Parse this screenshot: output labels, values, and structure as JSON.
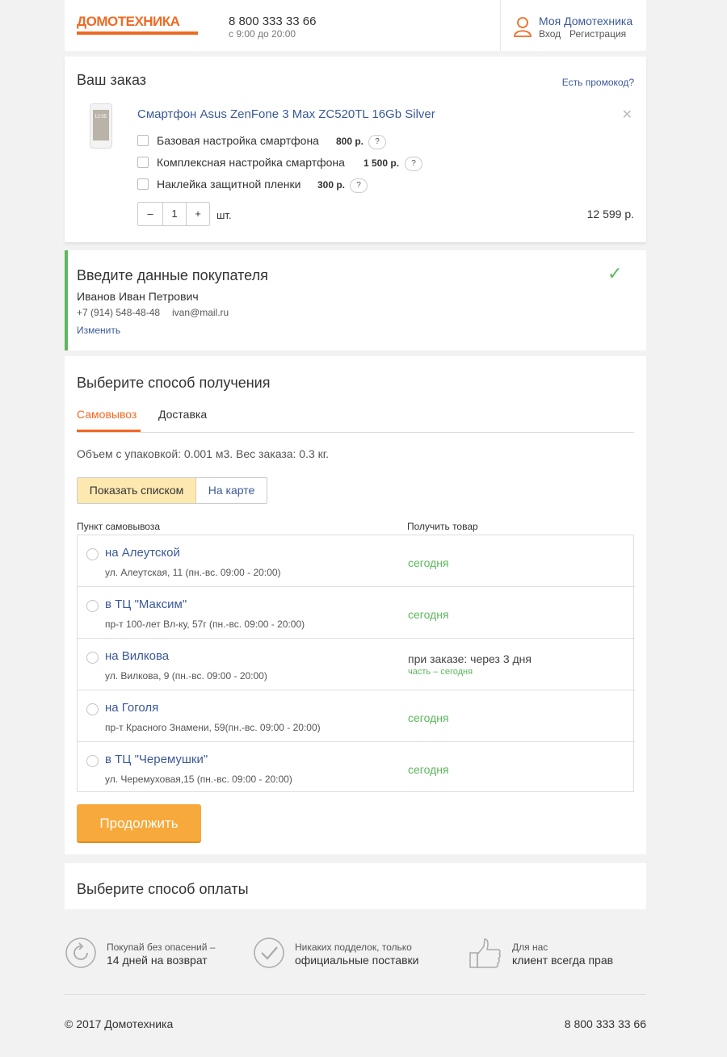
{
  "header": {
    "logo_text": "ДОМОТЕХНИКА",
    "phone": "8 800 333 33 66",
    "hours": "с 9:00 до 20:00",
    "account_title": "Моя Домотехника",
    "login": "Вход",
    "register": "Регистрация"
  },
  "order": {
    "title": "Ваш заказ",
    "promo_link": "Есть промокод?",
    "product_name": "Смартфон Asus ZenFone 3 Max ZC520TL 16Gb Silver",
    "phone_screen_time": "12:05",
    "options": [
      {
        "label": "Базовая настройка смартфона",
        "price": "800 р.",
        "help": "?"
      },
      {
        "label": "Комплексная настройка смартфона",
        "price": "1 500 р.",
        "help": "?"
      },
      {
        "label": "Наклейка защитной пленки",
        "price": "300 р.",
        "help": "?"
      }
    ],
    "qty_minus": "–",
    "qty_value": "1",
    "qty_plus": "+",
    "qty_unit": "шт.",
    "total": "12 599 р.",
    "remove": "✕"
  },
  "buyer": {
    "title": "Введите данные покупателя",
    "name": "Иванов Иван Петрович",
    "phone": "+7 (914) 548-48-48",
    "email": "ivan@mail.ru",
    "edit_link": "Изменить",
    "done_icon": "✓"
  },
  "delivery": {
    "title": "Выберите способ получения",
    "tabs": [
      "Самовывоз",
      "Доставка"
    ],
    "active_tab": 0,
    "volume_text": "Объем с упаковкой: 0.001 м3. Вес заказа: 0.3 кг.",
    "view_list": "Показать списком",
    "view_map": "На карте",
    "col_point": "Пункт самовывоза",
    "col_get": "Получить товар",
    "points": [
      {
        "name": "на Алеутской",
        "address": "ул. Алеутская, 11 (пн.-вс. 09:00 - 20:00)",
        "get": "сегодня",
        "sub": ""
      },
      {
        "name": "в ТЦ \"Максим\"",
        "address": "пр-т 100-лет Вл-ку, 57г (пн.-вс. 09:00 - 20:00)",
        "get": "сегодня",
        "sub": ""
      },
      {
        "name": "на Вилкова",
        "address": "ул. Вилкова, 9 (пн.-вс. 09:00 - 20:00)",
        "get": "при заказе: через 3 дня",
        "sub": "часть – сегодня"
      },
      {
        "name": "на Гоголя",
        "address": "пр-т Красного Знамени, 59(пн.-вс. 09:00 - 20:00)",
        "get": "сегодня",
        "sub": ""
      },
      {
        "name": "в ТЦ \"Черемушки\"",
        "address": "ул. Черемуховая,15 (пн.-вс. 09:00 - 20:00)",
        "get": "сегодня",
        "sub": ""
      }
    ],
    "continue": "Продолжить"
  },
  "payment": {
    "title": "Выберите способ оплаты"
  },
  "benefits": [
    {
      "top": "Покупай без опасений –",
      "bottom": "14 дней на возврат",
      "icon": "return-icon"
    },
    {
      "top": "Никаких подделок, только",
      "bottom": "официальные поставки",
      "icon": "check-circle-icon"
    },
    {
      "top": "Для нас",
      "bottom": "клиент всегда прав",
      "icon": "thumbs-up-icon"
    }
  ],
  "footer": {
    "copyright": "© 2017 Домотехника",
    "phone": "8 800 333 33 66"
  },
  "colors": {
    "brand": "#f06a23",
    "link": "#3b5998",
    "success": "#5cb85c",
    "button": "#f7a93b",
    "toggle_active": "#fde9b0"
  }
}
